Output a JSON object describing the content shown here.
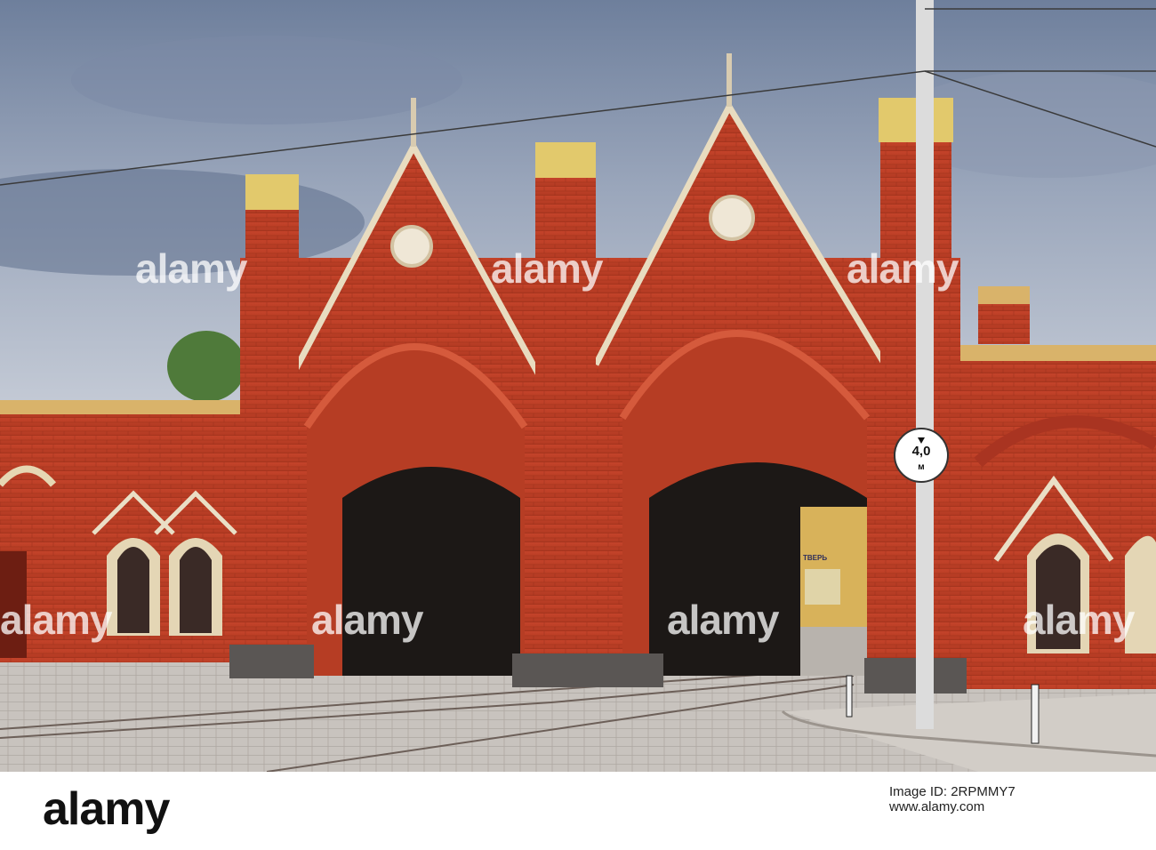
{
  "photo": {
    "description_alt": "",
    "sign": {
      "value": "4,0",
      "unit": "м"
    },
    "shop_sign": "ТВЕРЬ"
  },
  "watermark": {
    "text": "alamy"
  },
  "footer": {
    "logo": "alamy",
    "image_id_label": "Image ID: 2RPMMY7",
    "image_id_site": "www.alamy.com"
  }
}
